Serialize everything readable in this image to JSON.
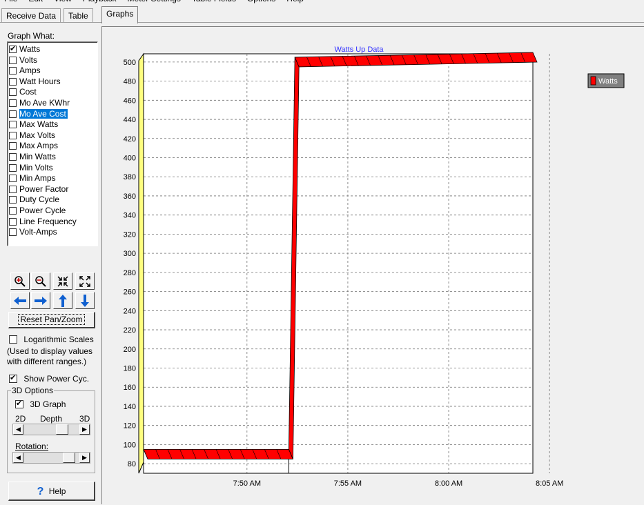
{
  "menu": [
    "File",
    "Edit",
    "View",
    "Playback",
    "Meter Settings",
    "Table Fields",
    "Options",
    "Help"
  ],
  "tabs": [
    {
      "label": "Receive Data"
    },
    {
      "label": "Table"
    },
    {
      "label": "Graphs"
    }
  ],
  "panel": {
    "graph_what_label": "Graph What:",
    "items": [
      {
        "label": "Watts",
        "checked": true,
        "selected": false
      },
      {
        "label": "Volts",
        "checked": false,
        "selected": false
      },
      {
        "label": "Amps",
        "checked": false,
        "selected": false
      },
      {
        "label": "Watt Hours",
        "checked": false,
        "selected": false
      },
      {
        "label": "Cost",
        "checked": false,
        "selected": false
      },
      {
        "label": "Mo Ave KWhr",
        "checked": false,
        "selected": false
      },
      {
        "label": "Mo Ave Cost",
        "checked": false,
        "selected": true
      },
      {
        "label": "Max Watts",
        "checked": false,
        "selected": false
      },
      {
        "label": "Max Volts",
        "checked": false,
        "selected": false
      },
      {
        "label": "Max Amps",
        "checked": false,
        "selected": false
      },
      {
        "label": "Min Watts",
        "checked": false,
        "selected": false
      },
      {
        "label": "Min Volts",
        "checked": false,
        "selected": false
      },
      {
        "label": "Min Amps",
        "checked": false,
        "selected": false
      },
      {
        "label": "Power Factor",
        "checked": false,
        "selected": false
      },
      {
        "label": "Duty Cycle",
        "checked": false,
        "selected": false
      },
      {
        "label": "Power Cycle",
        "checked": false,
        "selected": false
      },
      {
        "label": "Line Frequency",
        "checked": false,
        "selected": false
      },
      {
        "label": "Volt-Amps",
        "checked": false,
        "selected": false
      }
    ],
    "reset_label": "Reset Pan/Zoom",
    "log_label": "Logarithmic Scales",
    "log_checked": false,
    "log_note_1": "(Used to display values",
    "log_note_2": "with different ranges.)",
    "power_cycle_label": "Show Power Cyc.",
    "power_cycle_checked": true,
    "options_3d_label": "3D Options",
    "graph3d_label": "3D Graph",
    "graph3d_checked": true,
    "depth_2d": "2D",
    "depth_label": "Depth",
    "depth_3d": "3D",
    "rotation_label": "Rotation:",
    "help_label": "Help"
  },
  "chart_data": {
    "type": "area",
    "title": "Watts Up Data",
    "legend": [
      "Watts"
    ],
    "legend_position": "top-right",
    "series_color": "#ff0000",
    "wall_color": "#ffff80",
    "three_d": true,
    "grid": true,
    "ylim": [
      70,
      510
    ],
    "yticks": [
      80,
      100,
      120,
      140,
      160,
      180,
      200,
      220,
      240,
      260,
      280,
      300,
      320,
      340,
      360,
      380,
      400,
      420,
      440,
      460,
      480,
      500
    ],
    "xticks": [
      "7:50 AM",
      "7:55 AM",
      "8:00 AM",
      "8:05 AM"
    ],
    "xtick_minutes": [
      0,
      5,
      10,
      15
    ],
    "xlim_minutes": [
      -4.1,
      15.2
    ],
    "series": [
      {
        "name": "Watts",
        "x_minutes": [
          -4.1,
          3.1,
          3.4,
          15.2
        ],
        "y": [
          95,
          95,
          505,
          510
        ]
      }
    ]
  }
}
